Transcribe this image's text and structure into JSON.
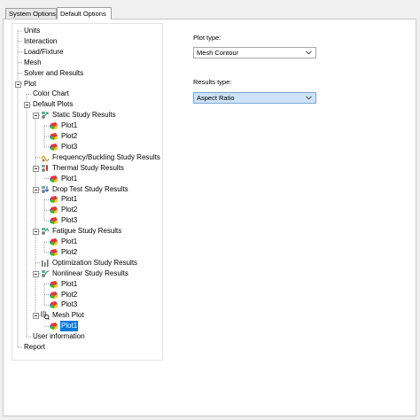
{
  "tabs": [
    {
      "label": "System Options",
      "active": false
    },
    {
      "label": "Default Options",
      "active": true
    }
  ],
  "tree": [
    {
      "label": "Units",
      "depth": 0,
      "icon": "none"
    },
    {
      "label": "Interaction",
      "depth": 0,
      "icon": "none"
    },
    {
      "label": "Load/Fixture",
      "depth": 0,
      "icon": "none"
    },
    {
      "label": "Mesh",
      "depth": 0,
      "icon": "none"
    },
    {
      "label": "Solver and Results",
      "depth": 0,
      "icon": "none"
    },
    {
      "label": "Plot",
      "depth": 0,
      "icon": "none",
      "expanded": true
    },
    {
      "label": "Color Chart",
      "depth": 1,
      "icon": "none"
    },
    {
      "label": "Default Plots",
      "depth": 1,
      "icon": "none",
      "expanded": true
    },
    {
      "label": "Static Study Results",
      "depth": 2,
      "icon": "static-study-icon",
      "expanded": true
    },
    {
      "label": "Plot1",
      "depth": 3,
      "icon": "result-plot-icon"
    },
    {
      "label": "Plot2",
      "depth": 3,
      "icon": "result-plot-icon"
    },
    {
      "label": "Plot3",
      "depth": 3,
      "icon": "result-plot-icon"
    },
    {
      "label": "Frequency/Buckling Study Results",
      "depth": 2,
      "icon": "frequency-study-icon"
    },
    {
      "label": "Thermal Study Results",
      "depth": 2,
      "icon": "thermal-study-icon",
      "expanded": true
    },
    {
      "label": "Plot1",
      "depth": 3,
      "icon": "result-plot-icon"
    },
    {
      "label": "Drop Test Study Results",
      "depth": 2,
      "icon": "drop-test-study-icon",
      "expanded": true
    },
    {
      "label": "Plot1",
      "depth": 3,
      "icon": "result-plot-icon"
    },
    {
      "label": "Plot2",
      "depth": 3,
      "icon": "result-plot-icon"
    },
    {
      "label": "Plot3",
      "depth": 3,
      "icon": "result-plot-icon"
    },
    {
      "label": "Fatigue Study Results",
      "depth": 2,
      "icon": "fatigue-study-icon",
      "expanded": true
    },
    {
      "label": "Plot1",
      "depth": 3,
      "icon": "result-plot-icon"
    },
    {
      "label": "Plot2",
      "depth": 3,
      "icon": "result-plot-icon"
    },
    {
      "label": "Optimization Study Results",
      "depth": 2,
      "icon": "optimization-study-icon"
    },
    {
      "label": "Nonlinear Study Results",
      "depth": 2,
      "icon": "nonlinear-study-icon",
      "expanded": true
    },
    {
      "label": "Plot1",
      "depth": 3,
      "icon": "result-plot-icon"
    },
    {
      "label": "Plot2",
      "depth": 3,
      "icon": "result-plot-icon"
    },
    {
      "label": "Plot3",
      "depth": 3,
      "icon": "result-plot-icon"
    },
    {
      "label": "Mesh Plot",
      "depth": 2,
      "icon": "mesh-plot-study-icon",
      "expanded": true
    },
    {
      "label": "Plot1",
      "depth": 3,
      "icon": "result-plot-icon",
      "selected": true
    },
    {
      "label": "User information",
      "depth": 1,
      "icon": "none"
    },
    {
      "label": "Report",
      "depth": 0,
      "icon": "none"
    }
  ],
  "plot_type": {
    "label": "Plot type:",
    "value": "Mesh Contour"
  },
  "results_type": {
    "label": "Results type:",
    "value": "Aspect Ratio"
  },
  "colors": {
    "selection": "#0078d7",
    "combo_highlight": "#cde3f7"
  }
}
